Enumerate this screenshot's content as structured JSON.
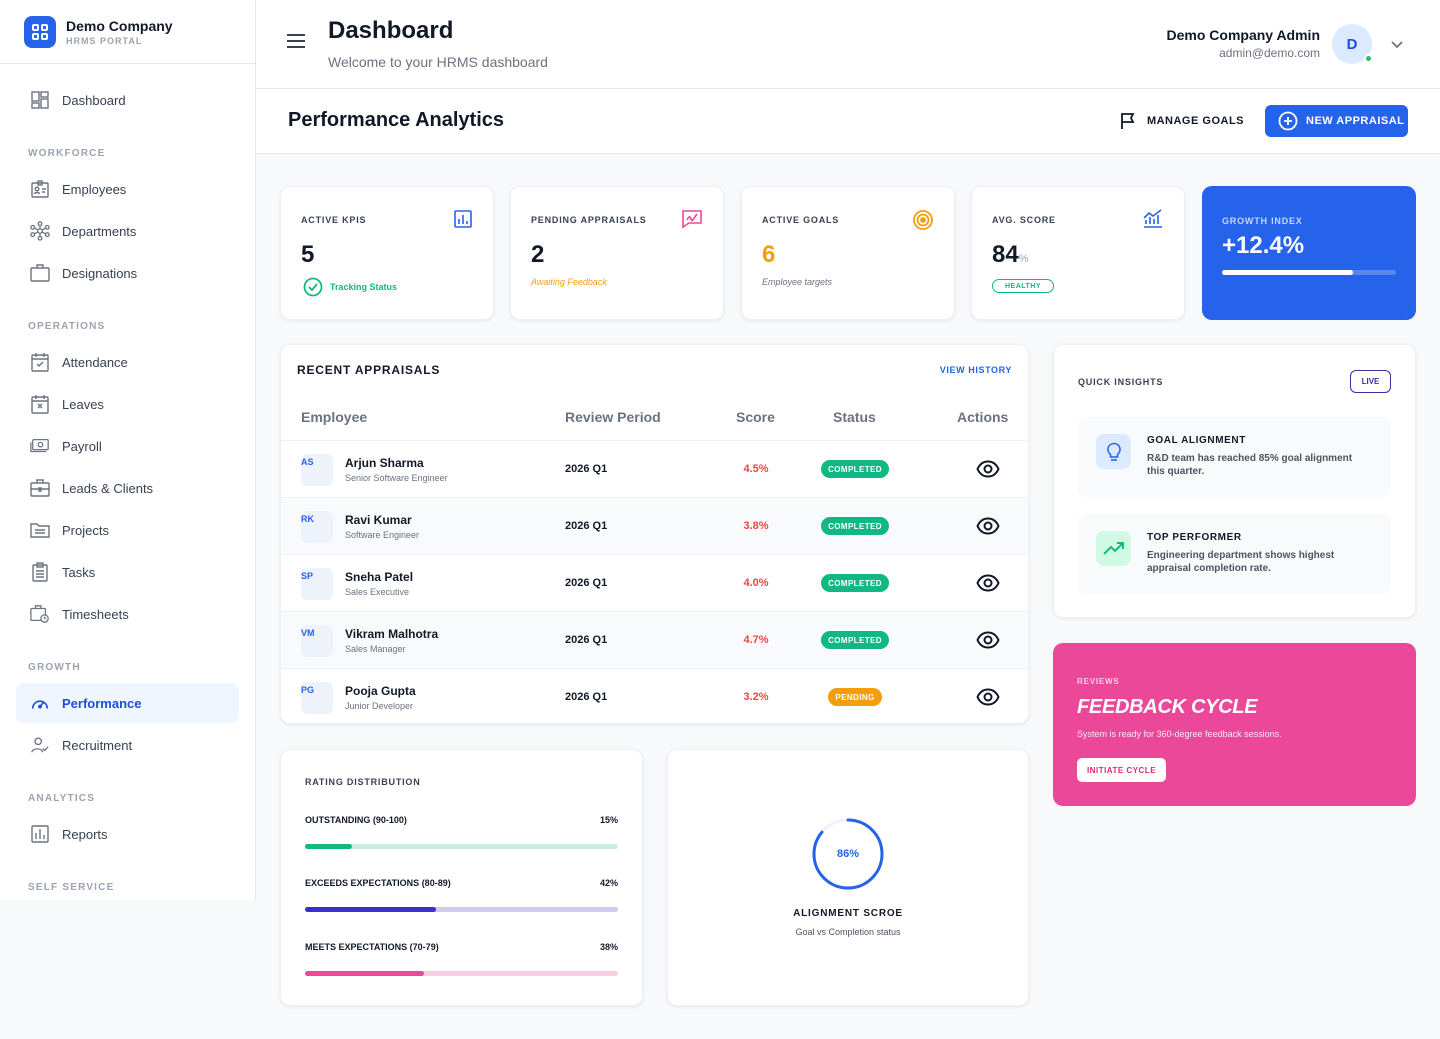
{
  "brand": {
    "name": "Demo Company",
    "subtitle": "HRMS PORTAL"
  },
  "sidebar": {
    "dashboard": "Dashboard",
    "sections": {
      "workforce": "WORKFORCE",
      "operations": "OPERATIONS",
      "growth": "GROWTH",
      "analytics": "ANALYTICS",
      "self_service": "SELF SERVICE"
    },
    "items": {
      "employees": "Employees",
      "departments": "Departments",
      "designations": "Designations",
      "attendance": "Attendance",
      "leaves": "Leaves",
      "payroll": "Payroll",
      "leads": "Leads & Clients",
      "projects": "Projects",
      "tasks": "Tasks",
      "timesheets": "Timesheets",
      "performance": "Performance",
      "recruitment": "Recruitment",
      "reports": "Reports"
    },
    "active": "performance"
  },
  "header": {
    "title": "Dashboard",
    "subtitle": "Welcome to your HRMS dashboard",
    "user_name": "Demo Company Admin",
    "user_email": "admin@demo.com",
    "avatar_initial": "D"
  },
  "subheader": {
    "title": "Performance Analytics",
    "manage_goals": "MANAGE GOALS",
    "new_appraisal": "NEW APPRAISAL"
  },
  "stats": {
    "kpis": {
      "label": "ACTIVE KPIS",
      "value": "5",
      "foot": "Tracking Status",
      "icon": "bar-chart-icon"
    },
    "appraisals": {
      "label": "PENDING APPRAISALS",
      "value": "2",
      "foot": "Awaiting Feedback",
      "icon": "signature-icon"
    },
    "goals": {
      "label": "ACTIVE GOALS",
      "value": "6",
      "foot": "Employee targets",
      "icon": "target-icon"
    },
    "score": {
      "label": "AVG. SCORE",
      "value": "84",
      "unit": "%",
      "badge": "HEALTHY",
      "icon": "trend-chart-icon"
    },
    "growth": {
      "label": "GROWTH INDEX",
      "value": "+12.4%",
      "progress": 0.75
    }
  },
  "appraisals": {
    "title": "RECENT APPRAISALS",
    "view_history": "VIEW HISTORY",
    "columns": [
      "Employee",
      "Review Period",
      "Score",
      "Status",
      "Actions"
    ],
    "rows": [
      {
        "initials": "AS",
        "name": "Arjun Sharma",
        "role": "Senior Software Engineer",
        "period": "2026 Q1",
        "score": "4.5%",
        "status": "COMPLETED"
      },
      {
        "initials": "RK",
        "name": "Ravi Kumar",
        "role": "Software Engineer",
        "period": "2026 Q1",
        "score": "3.8%",
        "status": "COMPLETED"
      },
      {
        "initials": "SP",
        "name": "Sneha Patel",
        "role": "Sales Executive",
        "period": "2026 Q1",
        "score": "4.0%",
        "status": "COMPLETED"
      },
      {
        "initials": "VM",
        "name": "Vikram Malhotra",
        "role": "Sales Manager",
        "period": "2026 Q1",
        "score": "4.7%",
        "status": "COMPLETED"
      },
      {
        "initials": "PG",
        "name": "Pooja Gupta",
        "role": "Junior Developer",
        "period": "2026 Q1",
        "score": "3.2%",
        "status": "PENDING"
      }
    ]
  },
  "insights": {
    "title": "QUICK INSIGHTS",
    "live": "LIVE",
    "items": [
      {
        "title": "GOAL ALIGNMENT",
        "text": "R&D team has reached 85% goal alignment this quarter.",
        "icon": "lightbulb-icon"
      },
      {
        "title": "TOP PERFORMER",
        "text": "Engineering department shows highest appraisal completion rate.",
        "icon": "trending-up-icon"
      }
    ]
  },
  "feedback": {
    "label": "REVIEWS",
    "title": "FEEDBACK CYCLE",
    "text": "System is ready for 360-degree feedback sessions.",
    "button": "INITIATE CYCLE"
  },
  "rating": {
    "title": "RATING DISTRIBUTION",
    "items": [
      {
        "label": "OUTSTANDING (90-100)",
        "pct": "15%",
        "value": 0.15,
        "color": "#10b981",
        "track": "#c9ede0"
      },
      {
        "label": "EXCEEDS EXPECTATIONS (80-89)",
        "pct": "42%",
        "value": 0.42,
        "color": "#3b2fc9",
        "track": "#cfcaee"
      },
      {
        "label": "MEETS EXPECTATIONS (70-79)",
        "pct": "38%",
        "value": 0.38,
        "color": "#ec4899",
        "track": "#f7cde2"
      }
    ]
  },
  "alignment": {
    "value": "86%",
    "fraction": 0.86,
    "title": "ALIGNMENT SCROE",
    "subtitle": "Goal vs Completion status"
  },
  "colors": {
    "primary": "#2563eb",
    "success": "#10b981",
    "warning": "#f59e0b",
    "danger": "#ef4444",
    "pink": "#ec4899"
  }
}
